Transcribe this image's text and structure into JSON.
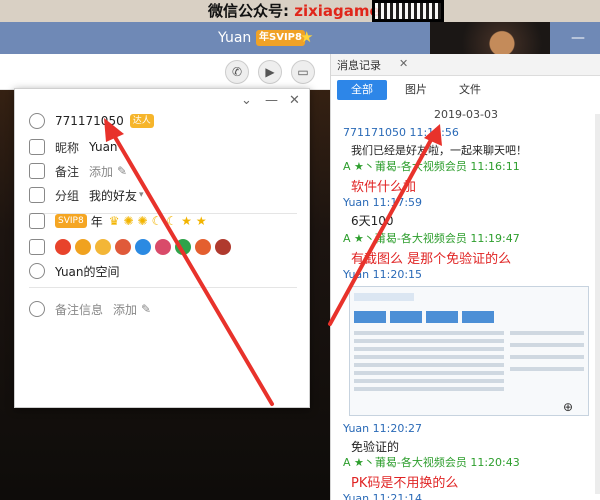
{
  "banner": {
    "prefix": "微信公众号: ",
    "highlight": "zixiagame"
  },
  "window": {
    "title": "Yuan",
    "vip_tag": "年SVIP8"
  },
  "profile": {
    "qq": "771171050",
    "talent": "达人",
    "nickname_label": "昵称",
    "nickname": "Yuan",
    "remark_label": "备注",
    "remark_add": "添加",
    "group_label": "分组",
    "group": "我的好友",
    "svip_badge": "SVIP8",
    "svip_year": "年",
    "space": "Yuan的空间",
    "remark_info_label": "备注信息",
    "remark_info_add": "添加"
  },
  "panel": {
    "tab": "消息记录",
    "filters": [
      "全部",
      "图片",
      "文件"
    ],
    "date": "2019-03-03",
    "messages": [
      {
        "sender": "771171050 11:15:56",
        "text": "我们已经是好友啦，一起来聊天吧！"
      },
      {
        "sender": "A ★丶莆曷-各大视频会员 11:16:11",
        "text": "软件什么加"
      },
      {
        "sender": "Yuan 11:17:59",
        "text": "6天100"
      },
      {
        "sender": "A ★丶莆曷-各大视频会员 11:19:47",
        "text": "有截图么  是那个免验证的么"
      },
      {
        "sender": "Yuan 11:20:15",
        "text": ""
      },
      {
        "sender": "Yuan 11:20:27",
        "text": "免验证的"
      },
      {
        "sender": "A ★丶莆曷-各大视频会员 11:20:43",
        "text": "PK码是不用换的么"
      },
      {
        "sender": "Yuan 11:21:14",
        "text": ""
      }
    ]
  },
  "colors": {
    "accent": "#2d86e8",
    "arrow": "#e8322b"
  }
}
